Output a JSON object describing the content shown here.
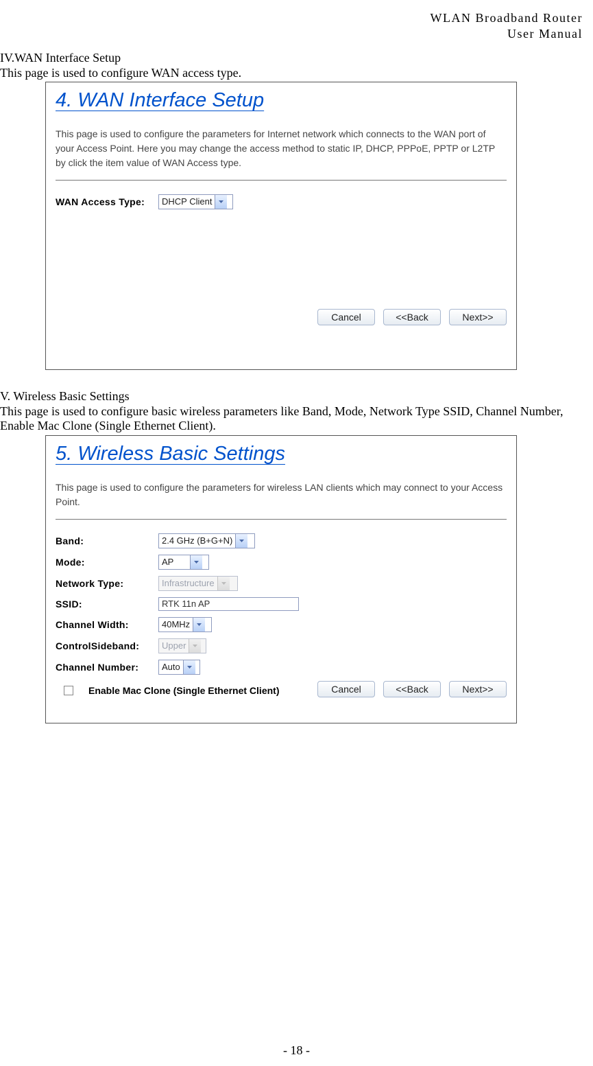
{
  "header": {
    "line1": "WLAN  Broadband  Router",
    "line2": "User  Manual"
  },
  "sec4": {
    "intro_heading": "IV.WAN Interface Setup",
    "intro_text": "This page is used to configure WAN access type.",
    "fig_title": "4. WAN Interface Setup",
    "fig_sub": "This page is used to configure the parameters for Internet network which connects to the WAN port of your Access Point. Here you may change the access method to static IP, DHCP, PPPoE, PPTP or L2TP by click the item value of WAN Access type.",
    "wan_access_label": "WAN Access Type:",
    "wan_access_value": "DHCP Client",
    "btn_cancel": "Cancel",
    "btn_back": "<<Back",
    "btn_next": "Next>>"
  },
  "sec5": {
    "intro_heading": "V. Wireless Basic Settings",
    "intro_text": "This page is used to configure basic wireless parameters like Band, Mode, Network Type SSID, Channel Number, Enable Mac Clone (Single Ethernet Client).",
    "fig_title": "5. Wireless Basic Settings",
    "fig_sub": "This page is used to configure the parameters for wireless LAN clients which may connect to your Access Point.",
    "rows": {
      "band_label": "Band:",
      "band_value": "2.4 GHz (B+G+N)",
      "mode_label": "Mode:",
      "mode_value": "AP",
      "nettype_label": "Network Type:",
      "nettype_value": "Infrastructure",
      "ssid_label": "SSID:",
      "ssid_value": "RTK 11n AP",
      "cw_label": "Channel Width:",
      "cw_value": "40MHz",
      "sb_label": "ControlSideband:",
      "sb_value": "Upper",
      "cn_label": "Channel Number:",
      "cn_value": "Auto"
    },
    "checkbox_label": "Enable Mac Clone (Single Ethernet Client)",
    "btn_cancel": "Cancel",
    "btn_back": "<<Back",
    "btn_next": "Next>>"
  },
  "page_number": "- 18 -"
}
